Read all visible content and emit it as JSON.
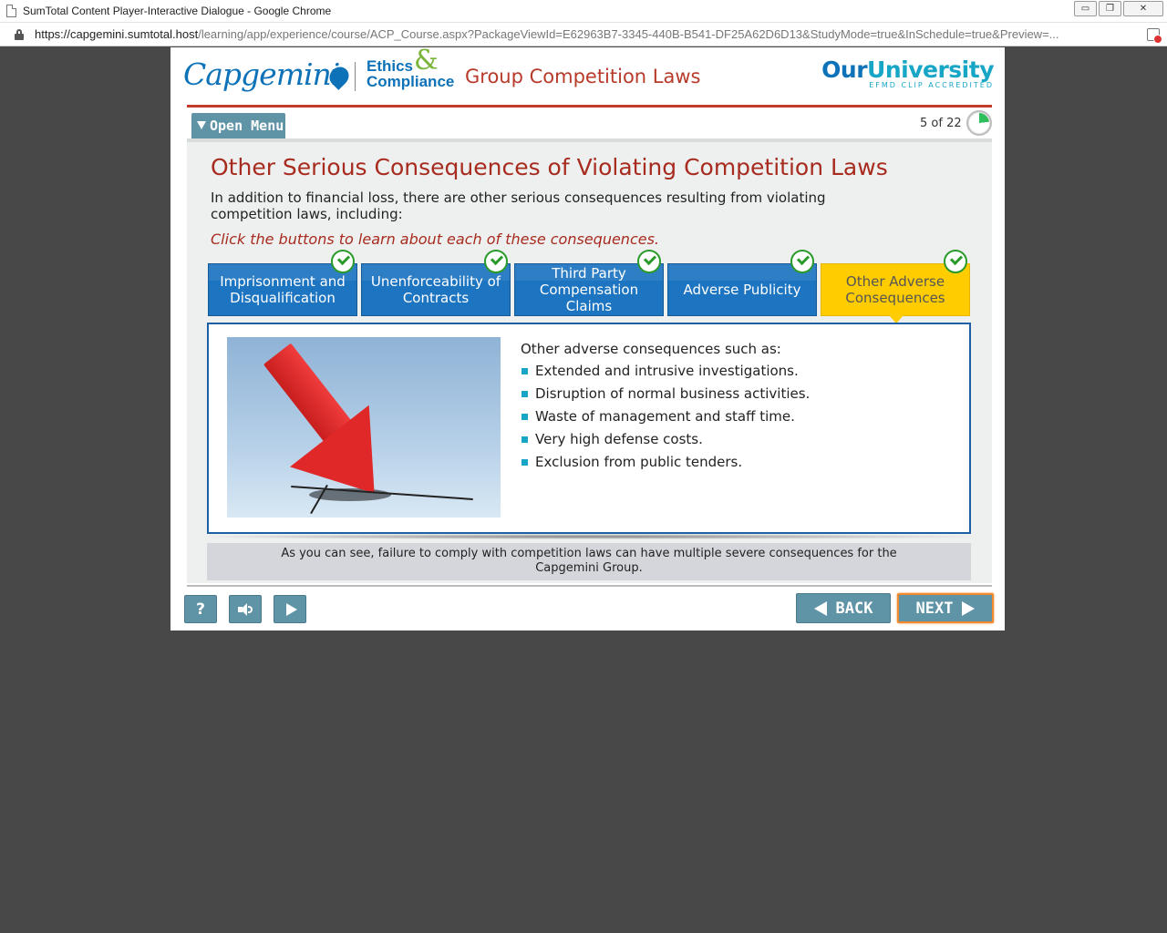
{
  "browser": {
    "window_title": "SumTotal Content Player-Interactive Dialogue - Google Chrome",
    "url_host": "https://capgemini.sumtotal.host",
    "url_path": "/learning/app/experience/course/ACP_Course.aspx?PackageViewId=E62963B7-3345-440B-B541-DF25A62D6D13&StudyMode=true&InSchedule=true&Preview=...",
    "controls": {
      "minimize": "▭",
      "restore": "❐",
      "close": "✕"
    }
  },
  "header": {
    "brand": "Capgemini",
    "ethics_line1": "Ethics",
    "ethics_amp": "&",
    "ethics_line2": "Compliance",
    "course_title": "Group Competition Laws",
    "university_our": "Our",
    "university_name": "University",
    "university_sub": "EFMD CLIP ACCREDITED"
  },
  "menu": {
    "open_label": "Open Menu"
  },
  "progress": {
    "page_text": "5 of 22",
    "fraction": 0.227
  },
  "slide": {
    "title": "Other Serious Consequences of Violating Competition Laws",
    "intro": "In addition to financial loss, there are other serious consequences resulting from violating competition laws, including:",
    "instruction": "Click the buttons to learn about each of these consequences."
  },
  "tabs": [
    {
      "label": "Imprisonment and Disqualification",
      "visited": true,
      "active": false
    },
    {
      "label": "Unenforceability of Contracts",
      "visited": true,
      "active": false
    },
    {
      "label": "Third Party Compensation Claims",
      "visited": true,
      "active": false
    },
    {
      "label": "Adverse Publicity",
      "visited": true,
      "active": false
    },
    {
      "label": "Other Adverse Consequences",
      "visited": true,
      "active": true
    }
  ],
  "content": {
    "lead": "Other adverse consequences such as:",
    "bullets": [
      "Extended and intrusive investigations.",
      "Disruption of normal business activities.",
      "Waste of management and staff time.",
      "Very high defense costs.",
      "Exclusion from public tenders."
    ]
  },
  "caption": "As you can see, failure to comply with competition laws can have multiple severe consequences for the Capgemini Group.",
  "controls": {
    "help": "?",
    "back": "BACK",
    "next": "NEXT"
  },
  "colors": {
    "brand_blue": "#0d72b8",
    "title_red": "#a72b1e",
    "tab_blue": "#1d74c1",
    "tab_active": "#ffcc00",
    "control_teal": "#5f93a6",
    "progress_green": "#2fbf5a"
  },
  "icons": {
    "lock": "lock-icon",
    "check": "checkmark-circle-icon",
    "audio": "speaker-icon",
    "play": "play-icon",
    "back": "arrow-left-icon",
    "next": "arrow-right-icon"
  }
}
